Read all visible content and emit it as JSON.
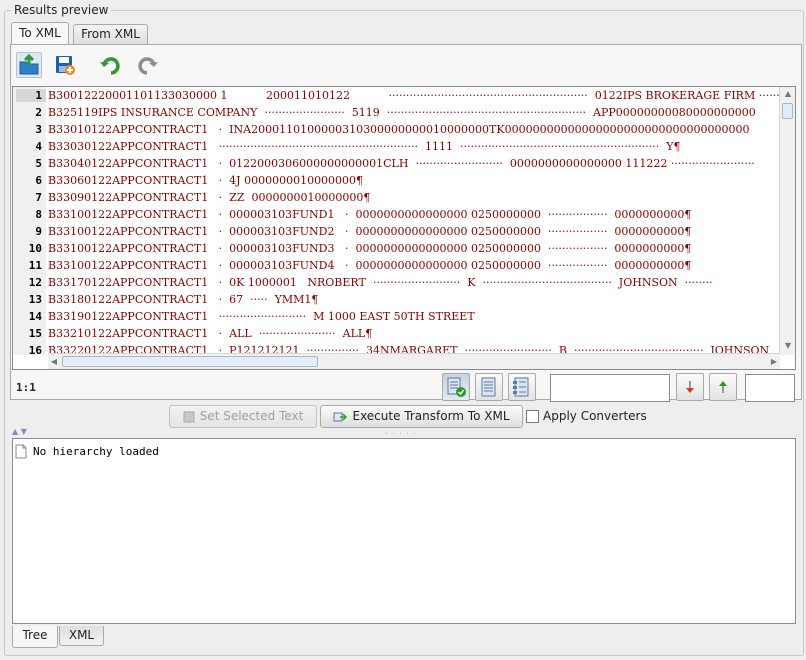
{
  "group_title": "Results preview",
  "top_tabs": {
    "to_xml": "To XML",
    "from_xml": "From XML"
  },
  "toolbar": {
    "open_icon": "open-folder-icon",
    "save_icon": "save-disk-icon",
    "undo_icon": "undo-icon",
    "redo_icon": "redo-icon"
  },
  "editor": {
    "line_numbers": [
      "1",
      "2",
      "3",
      "4",
      "5",
      "6",
      "7",
      "8",
      "9",
      "10",
      "11",
      "12",
      "13",
      "14",
      "15",
      "16"
    ],
    "lines": [
      "B30012220001101133030000 1           200011010122           ·························································  0122IPS BROKERAGE FIRM ········",
      "B325119IPS INSURANCE COMPANY  ·······················  5119  ·························································  APP00000000080000000000",
      "B33010122APPCONTRACT1   ·  INA2000110100000310300000000010000000TK00000000000000000000000000000000000",
      "B33030122APPCONTRACT1   ·························································  1111  ·························································  Y¶",
      "B33040122APPCONTRACT1   ·  0122000306000000000001CLH  ·························  0000000000000000 111222 ························",
      "B33060122APPCONTRACT1   ·  4J 0000000010000000¶",
      "B33090122APPCONTRACT1   ·  ZZ  0000000010000000¶",
      "B33100122APPCONTRACT1   ·  000003103FUND1   ·  0000000000000000 0250000000  ·················  0000000000¶",
      "B33100122APPCONTRACT1   ·  000003103FUND2   ·  0000000000000000 0250000000  ·················  0000000000¶",
      "B33100122APPCONTRACT1   ·  000003103FUND3   ·  0000000000000000 0250000000  ·················  0000000000¶",
      "B33100122APPCONTRACT1   ·  000003103FUND4   ·  0000000000000000 0250000000  ·················  0000000000¶",
      "B33170122APPCONTRACT1   ·  0K 1000001   NROBERT  ·························  K  ·····································  JOHNSON  ········",
      "B33180122APPCONTRACT1   ·  67  ·····  YMM1¶",
      "B33190122APPCONTRACT1   ·························  M 1000 EAST 50TH STREET",
      "B33210122APPCONTRACT1   ·  ALL  ······················  ALL¶",
      "B33220122APPCONTRACT1   ·  P121212121  ···············  34NMARGARET  ·························  B  ·····································  JOHNSON"
    ]
  },
  "status": {
    "cursor_position": "1:1"
  },
  "view_buttons": {
    "view_a_icon": "document-check-icon",
    "view_b_icon": "document-lines-icon",
    "view_c_icon": "document-list-icon",
    "find_next_icon": "arrow-down-icon",
    "find_prev_icon": "arrow-up-icon"
  },
  "actions": {
    "set_selected_text": "Set Selected Text",
    "execute_transform": "Execute Transform To XML",
    "apply_converters": "Apply Converters"
  },
  "tree": {
    "empty_message": "No hierarchy loaded"
  },
  "bottom_tabs": {
    "tree": "Tree",
    "xml": "XML"
  }
}
